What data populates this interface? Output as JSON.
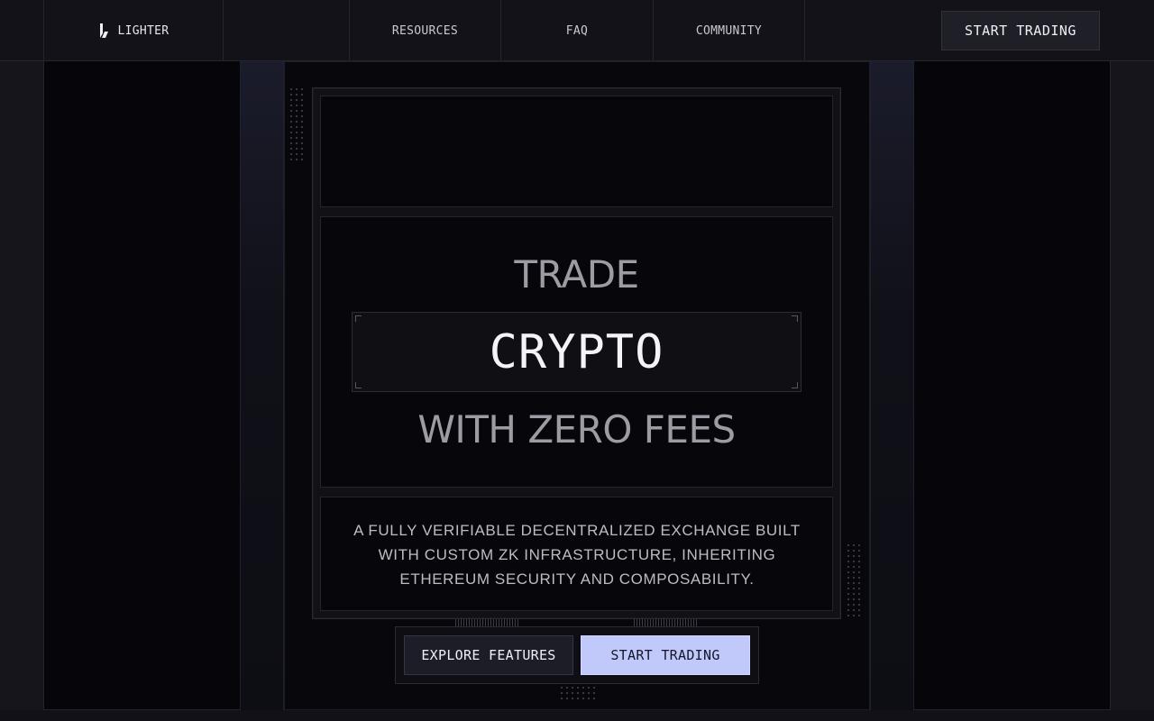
{
  "nav": {
    "logo_text": "LIGHTER",
    "links": {
      "resources": "RESOURCES",
      "faq": "FAQ",
      "community": "COMMUNITY"
    },
    "cta_label": "START TRADING"
  },
  "hero": {
    "line1": "TRADE",
    "line2": "CRYPTO",
    "line3": "WITH ZERO FEES",
    "description": "A FULLY VERIFIABLE DECENTRALIZED EXCHANGE BUILT WITH CUSTOM ZK INFRASTRUCTURE, INHERITING ETHEREUM SECURITY AND COMPOSABILITY."
  },
  "cta": {
    "explore_label": "EXPLORE FEATURES",
    "start_label": "START TRADING"
  },
  "colors": {
    "accent": "#c1c9fb",
    "background": "#06060a",
    "nav_bg": "#121218"
  },
  "icons": {
    "logo": "lighter-logo-icon"
  }
}
